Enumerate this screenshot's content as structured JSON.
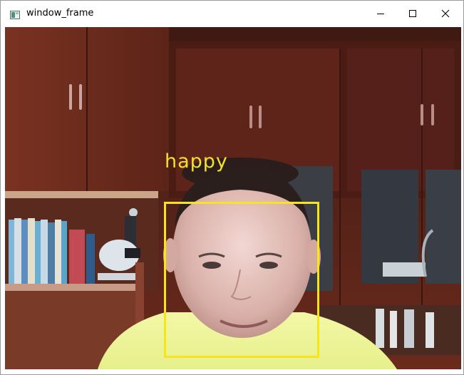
{
  "window": {
    "title": "window_frame",
    "icons": {
      "app": "app-window-icon",
      "minimize": "minimize-icon",
      "maximize": "maximize-icon",
      "close": "close-icon"
    }
  },
  "detection": {
    "label": "happy",
    "box_color": "#f7e41a",
    "label_color": "#f2e12a"
  }
}
